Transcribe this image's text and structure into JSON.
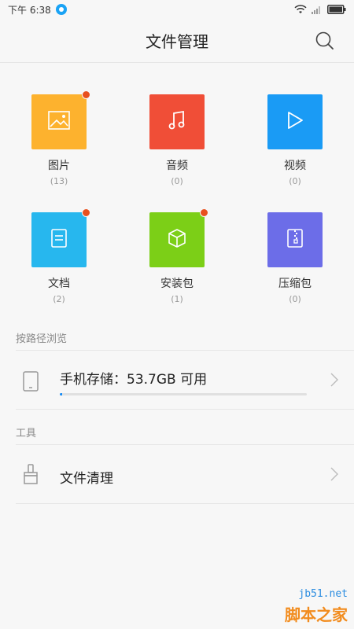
{
  "status": {
    "time": "下午 6:38"
  },
  "header": {
    "title": "文件管理"
  },
  "categories": [
    {
      "label": "图片",
      "count": "(13)",
      "color": "#fdb22e",
      "icon": "image-icon",
      "badge": true
    },
    {
      "label": "音频",
      "count": "(0)",
      "color": "#f04e37",
      "icon": "music-note-icon",
      "badge": false
    },
    {
      "label": "视频",
      "count": "(0)",
      "color": "#1a9bf5",
      "icon": "play-icon",
      "badge": false
    },
    {
      "label": "文档",
      "count": "(2)",
      "color": "#27b7ee",
      "icon": "document-icon",
      "badge": true
    },
    {
      "label": "安装包",
      "count": "(1)",
      "color": "#7ccf17",
      "icon": "package-icon",
      "badge": true
    },
    {
      "label": "压缩包",
      "count": "(0)",
      "color": "#6c6de8",
      "icon": "archive-icon",
      "badge": false
    }
  ],
  "browse": {
    "title": "按路径浏览",
    "storage_label": "手机存储：53.7GB 可用",
    "storage_used_fraction": 0.01
  },
  "tools": {
    "title": "工具",
    "cleanup_label": "文件清理"
  },
  "watermark": {
    "line1": "jb51.net",
    "line2": "脚本之家"
  },
  "colors": {
    "accent": "#1a8df5",
    "badge": "#e8501e"
  }
}
